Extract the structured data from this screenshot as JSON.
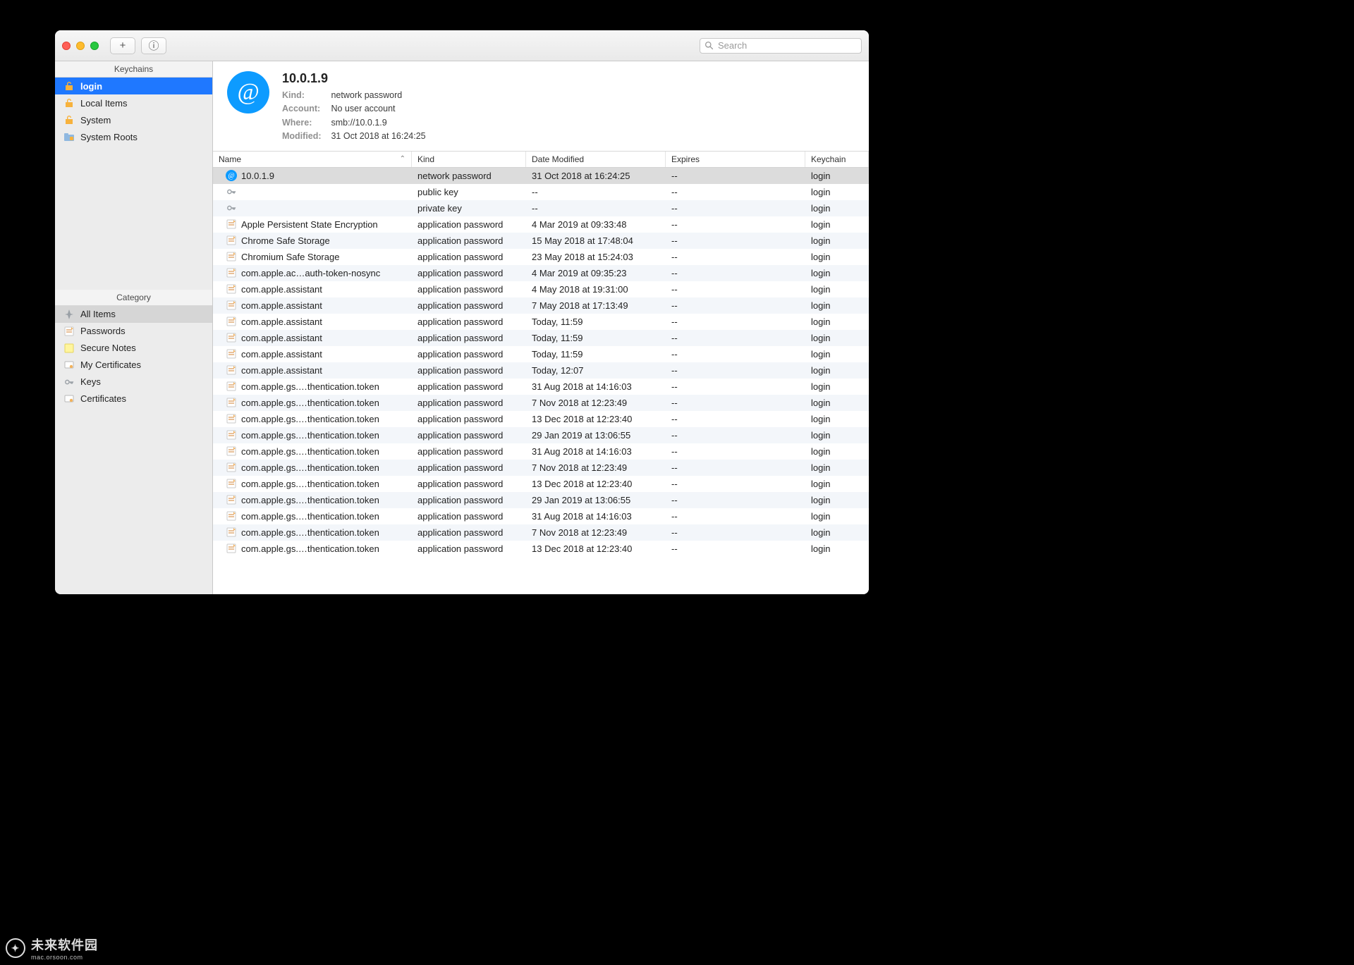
{
  "toolbar": {
    "add_label": "+",
    "info_label": "ⓘ",
    "search_placeholder": "Search"
  },
  "sidebar": {
    "keychains_header": "Keychains",
    "keychains": [
      {
        "label": "login",
        "icon": "lock-open",
        "selected": true
      },
      {
        "label": "Local Items",
        "icon": "lock-open",
        "selected": false
      },
      {
        "label": "System",
        "icon": "lock-open",
        "selected": false
      },
      {
        "label": "System Roots",
        "icon": "folder-lock",
        "selected": false
      }
    ],
    "category_header": "Category",
    "categories": [
      {
        "label": "All Items",
        "icon": "compass",
        "selected": true
      },
      {
        "label": "Passwords",
        "icon": "note",
        "selected": false
      },
      {
        "label": "Secure Notes",
        "icon": "sticky",
        "selected": false
      },
      {
        "label": "My Certificates",
        "icon": "cert",
        "selected": false
      },
      {
        "label": "Keys",
        "icon": "key",
        "selected": false
      },
      {
        "label": "Certificates",
        "icon": "cert",
        "selected": false
      }
    ]
  },
  "detail": {
    "title": "10.0.1.9",
    "kind_label": "Kind:",
    "kind_value": "network password",
    "account_label": "Account:",
    "account_value": "No user account",
    "where_label": "Where:",
    "where_value": "smb://10.0.1.9",
    "modified_label": "Modified:",
    "modified_value": "31 Oct 2018 at 16:24:25"
  },
  "columns": {
    "name": "Name",
    "kind": "Kind",
    "date": "Date Modified",
    "expires": "Expires",
    "keychain": "Keychain"
  },
  "rows": [
    {
      "icon": "at",
      "name": "10.0.1.9",
      "kind": "network password",
      "date": "31 Oct 2018 at 16:24:25",
      "exp": "--",
      "kc": "login",
      "selected": true
    },
    {
      "icon": "key",
      "name": "<key>",
      "kind": "public key",
      "date": "--",
      "exp": "--",
      "kc": "login"
    },
    {
      "icon": "key",
      "name": "<key>",
      "kind": "private key",
      "date": "--",
      "exp": "--",
      "kc": "login"
    },
    {
      "icon": "note",
      "name": "Apple Persistent State Encryption",
      "kind": "application password",
      "date": "4 Mar 2019 at 09:33:48",
      "exp": "--",
      "kc": "login"
    },
    {
      "icon": "note",
      "name": "Chrome Safe Storage",
      "kind": "application password",
      "date": "15 May 2018 at 17:48:04",
      "exp": "--",
      "kc": "login"
    },
    {
      "icon": "note",
      "name": "Chromium Safe Storage",
      "kind": "application password",
      "date": "23 May 2018 at 15:24:03",
      "exp": "--",
      "kc": "login"
    },
    {
      "icon": "note",
      "name": "com.apple.ac…auth-token-nosync",
      "kind": "application password",
      "date": "4 Mar 2019 at 09:35:23",
      "exp": "--",
      "kc": "login"
    },
    {
      "icon": "note",
      "name": "com.apple.assistant",
      "kind": "application password",
      "date": "4 May 2018 at 19:31:00",
      "exp": "--",
      "kc": "login"
    },
    {
      "icon": "note",
      "name": "com.apple.assistant",
      "kind": "application password",
      "date": "7 May 2018 at 17:13:49",
      "exp": "--",
      "kc": "login"
    },
    {
      "icon": "note",
      "name": "com.apple.assistant",
      "kind": "application password",
      "date": "Today, 11:59",
      "exp": "--",
      "kc": "login"
    },
    {
      "icon": "note",
      "name": "com.apple.assistant",
      "kind": "application password",
      "date": "Today, 11:59",
      "exp": "--",
      "kc": "login"
    },
    {
      "icon": "note",
      "name": "com.apple.assistant",
      "kind": "application password",
      "date": "Today, 11:59",
      "exp": "--",
      "kc": "login"
    },
    {
      "icon": "note",
      "name": "com.apple.assistant",
      "kind": "application password",
      "date": "Today, 12:07",
      "exp": "--",
      "kc": "login"
    },
    {
      "icon": "note",
      "name": "com.apple.gs.…thentication.token",
      "kind": "application password",
      "date": "31 Aug 2018 at 14:16:03",
      "exp": "--",
      "kc": "login"
    },
    {
      "icon": "note",
      "name": "com.apple.gs.…thentication.token",
      "kind": "application password",
      "date": "7 Nov 2018 at 12:23:49",
      "exp": "--",
      "kc": "login"
    },
    {
      "icon": "note",
      "name": "com.apple.gs.…thentication.token",
      "kind": "application password",
      "date": "13 Dec 2018 at 12:23:40",
      "exp": "--",
      "kc": "login"
    },
    {
      "icon": "note",
      "name": "com.apple.gs.…thentication.token",
      "kind": "application password",
      "date": "29 Jan 2019 at 13:06:55",
      "exp": "--",
      "kc": "login"
    },
    {
      "icon": "note",
      "name": "com.apple.gs.…thentication.token",
      "kind": "application password",
      "date": "31 Aug 2018 at 14:16:03",
      "exp": "--",
      "kc": "login"
    },
    {
      "icon": "note",
      "name": "com.apple.gs.…thentication.token",
      "kind": "application password",
      "date": "7 Nov 2018 at 12:23:49",
      "exp": "--",
      "kc": "login"
    },
    {
      "icon": "note",
      "name": "com.apple.gs.…thentication.token",
      "kind": "application password",
      "date": "13 Dec 2018 at 12:23:40",
      "exp": "--",
      "kc": "login"
    },
    {
      "icon": "note",
      "name": "com.apple.gs.…thentication.token",
      "kind": "application password",
      "date": "29 Jan 2019 at 13:06:55",
      "exp": "--",
      "kc": "login"
    },
    {
      "icon": "note",
      "name": "com.apple.gs.…thentication.token",
      "kind": "application password",
      "date": "31 Aug 2018 at 14:16:03",
      "exp": "--",
      "kc": "login"
    },
    {
      "icon": "note",
      "name": "com.apple.gs.…thentication.token",
      "kind": "application password",
      "date": "7 Nov 2018 at 12:23:49",
      "exp": "--",
      "kc": "login"
    },
    {
      "icon": "note",
      "name": "com.apple.gs.…thentication.token",
      "kind": "application password",
      "date": "13 Dec 2018 at 12:23:40",
      "exp": "--",
      "kc": "login"
    }
  ],
  "watermark": {
    "text": "未来软件园",
    "sub": "mac.orsoon.com"
  }
}
